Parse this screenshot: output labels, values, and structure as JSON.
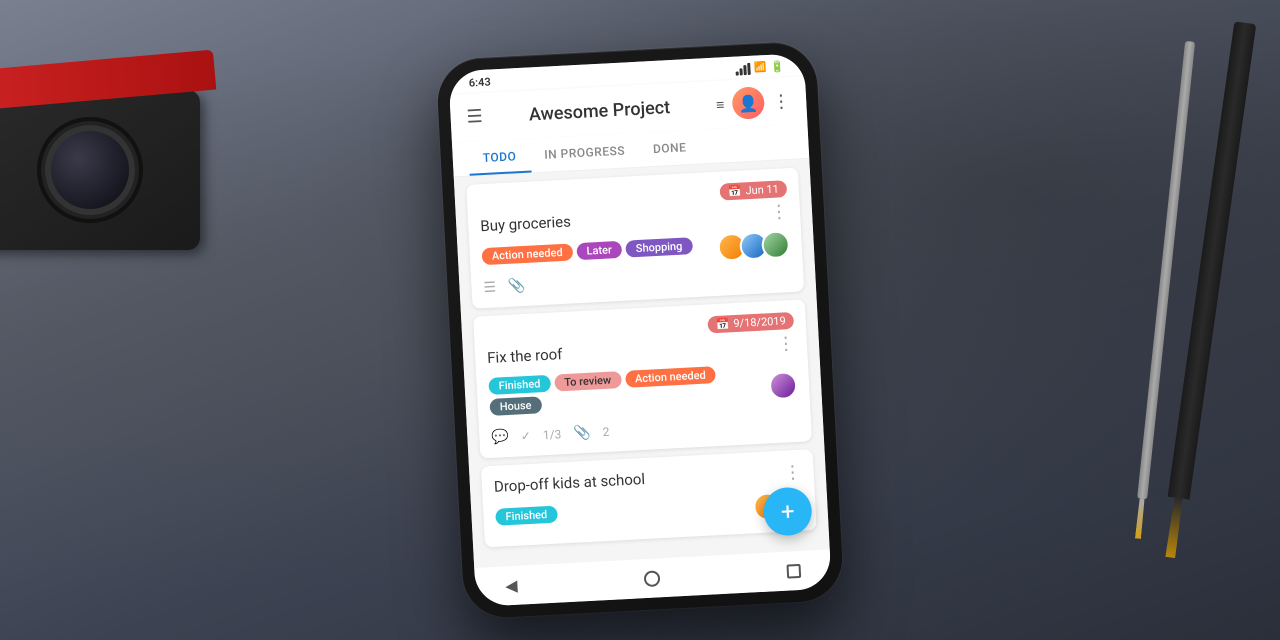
{
  "scene": {
    "bg_desc": "Dark slate desk background"
  },
  "phone": {
    "status_bar": {
      "time": "6:43",
      "wifi": "WiFi",
      "signal": "Signal",
      "battery": "Battery"
    },
    "header": {
      "title": "Awesome Project",
      "menu_icon": "☰",
      "more_icon": "⋮",
      "filter_icon": "≡"
    },
    "tabs": [
      {
        "label": "TODO",
        "active": true
      },
      {
        "label": "IN PROGRESS",
        "active": false
      },
      {
        "label": "DONE",
        "active": false
      }
    ],
    "tasks": [
      {
        "id": "task-1",
        "title": "Buy groceries",
        "date": "Jun 11",
        "date_color": "#e57373",
        "tags": [
          {
            "label": "Action needed",
            "class": "tag-action"
          },
          {
            "label": "Later",
            "class": "tag-later"
          },
          {
            "label": "Shopping",
            "class": "tag-shopping"
          }
        ],
        "has_avatars": true,
        "footer_icons": [
          "comment",
          "attachment"
        ]
      },
      {
        "id": "task-2",
        "title": "Fix the roof",
        "date": "9/18/2019",
        "date_color": "#e57373",
        "tags": [
          {
            "label": "Finished",
            "class": "tag-finished"
          },
          {
            "label": "To review",
            "class": "tag-review"
          },
          {
            "label": "Action needed",
            "class": "tag-action"
          },
          {
            "label": "House",
            "class": "tag-house"
          }
        ],
        "has_avatars": true,
        "footer_icons": [
          "comment",
          "check",
          "attachment"
        ],
        "subtask_text": "1/3",
        "attachment_count": "2"
      },
      {
        "id": "task-3",
        "title": "Drop-off kids at school",
        "date": null,
        "tags": [
          {
            "label": "Finished",
            "class": "tag-finished"
          }
        ],
        "has_avatars": true,
        "footer_icons": []
      }
    ],
    "fab": "+",
    "nav": {
      "back": "◀",
      "home": "●",
      "recent": "■"
    }
  }
}
